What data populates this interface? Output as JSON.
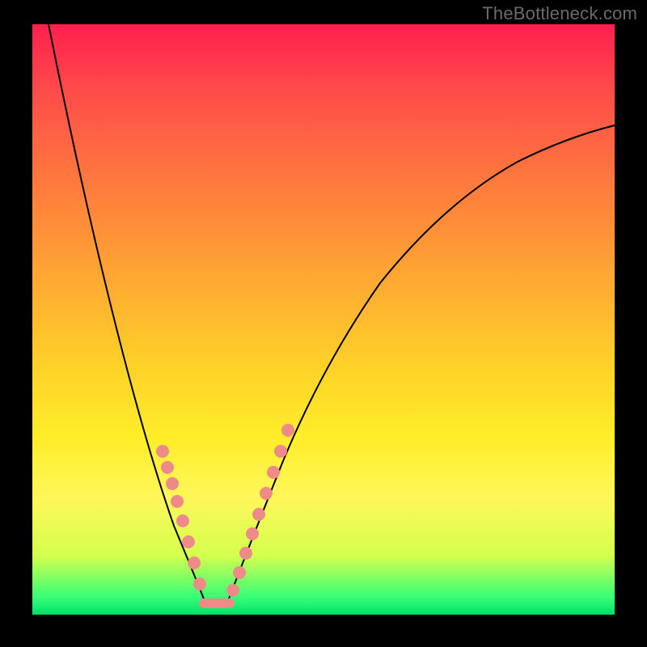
{
  "watermark": "TheBottleneck.com",
  "chart_data": {
    "type": "line",
    "title": "",
    "xlabel": "",
    "ylabel": "",
    "xlim": [
      0,
      100
    ],
    "ylim": [
      0,
      100
    ],
    "grid": false,
    "legend": false,
    "background_gradient": {
      "top_color": "#ff1f4e",
      "bottom_color": "#00e06a",
      "description": "red→orange→yellow→green vertical gradient"
    },
    "series": [
      {
        "name": "left-curve",
        "x": [
          3,
          6,
          9,
          12,
          15,
          18,
          21,
          24,
          27,
          30
        ],
        "y": [
          100,
          80,
          63,
          50,
          40,
          31,
          23,
          15,
          8,
          2
        ]
      },
      {
        "name": "right-curve",
        "x": [
          34,
          38,
          42,
          47,
          53,
          60,
          68,
          77,
          88,
          100
        ],
        "y": [
          2,
          9,
          17,
          26,
          36,
          46,
          56,
          65,
          73,
          80
        ]
      },
      {
        "name": "markers",
        "x": [
          22,
          23,
          24,
          25,
          26,
          27,
          28,
          30,
          31,
          33,
          34,
          36,
          37,
          38,
          39,
          40,
          41
        ],
        "y": [
          28,
          24,
          20,
          16,
          12,
          8,
          5,
          2,
          2,
          2,
          4,
          8,
          12,
          16,
          20,
          25,
          30
        ],
        "style": "pink-dots"
      }
    ]
  }
}
